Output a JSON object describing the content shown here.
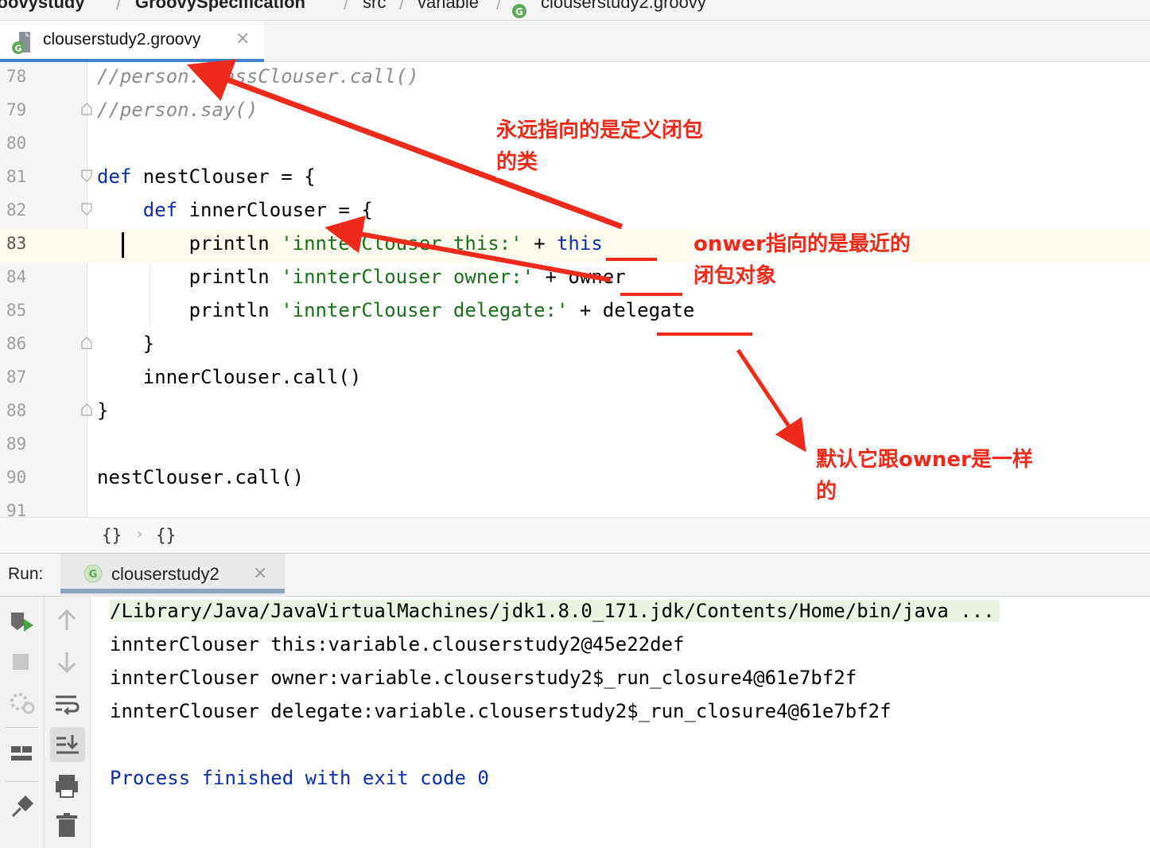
{
  "breadcrumb": {
    "items": [
      "roovystudy",
      "GroovySpecification",
      "src",
      "variable",
      "clouserstudy2.groovy"
    ],
    "separator": "/"
  },
  "editor_tab": {
    "file_name": "clouserstudy2.groovy",
    "close_glyph": "×",
    "icon": "groovy-file-icon"
  },
  "editor": {
    "lines": [
      {
        "num": "78",
        "parts": [
          {
            "t": "//person.classClouser.call()",
            "c": "cmt"
          }
        ]
      },
      {
        "num": "79",
        "parts": [
          {
            "t": "//person.say()",
            "c": "cmt"
          }
        ]
      },
      {
        "num": "80",
        "parts": []
      },
      {
        "num": "81",
        "parts": [
          {
            "t": "def",
            "c": "kw"
          },
          {
            "t": " nestClouser = {",
            "c": ""
          }
        ]
      },
      {
        "num": "82",
        "parts": [
          {
            "t": "    ",
            "c": ""
          },
          {
            "t": "def",
            "c": "kw"
          },
          {
            "t": " innerClouser = {",
            "c": ""
          }
        ]
      },
      {
        "num": "83",
        "parts": [
          {
            "t": "        println ",
            "c": ""
          },
          {
            "t": "'innterClouser this:'",
            "c": "str"
          },
          {
            "t": " + ",
            "c": ""
          },
          {
            "t": "this",
            "c": "kw"
          }
        ],
        "current": true
      },
      {
        "num": "84",
        "parts": [
          {
            "t": "        println ",
            "c": ""
          },
          {
            "t": "'innterClouser owner:'",
            "c": "str"
          },
          {
            "t": " + owner",
            "c": ""
          }
        ]
      },
      {
        "num": "85",
        "parts": [
          {
            "t": "        println ",
            "c": ""
          },
          {
            "t": "'innterClouser delegate:'",
            "c": "str"
          },
          {
            "t": " + delegate",
            "c": ""
          }
        ]
      },
      {
        "num": "86",
        "parts": [
          {
            "t": "    }",
            "c": ""
          }
        ]
      },
      {
        "num": "87",
        "parts": [
          {
            "t": "    innerClouser.call()",
            "c": ""
          }
        ]
      },
      {
        "num": "88",
        "parts": [
          {
            "t": "}",
            "c": ""
          }
        ]
      },
      {
        "num": "89",
        "parts": []
      },
      {
        "num": "90",
        "parts": [
          {
            "t": "nestClouser.call()",
            "c": ""
          }
        ]
      },
      {
        "num": "91",
        "parts": []
      }
    ]
  },
  "structure": {
    "items": [
      "{}",
      "{}"
    ],
    "separator": "›"
  },
  "run": {
    "label": "Run:",
    "tab_label": "clouserstudy2",
    "tab_icon_letter": "G",
    "close_glyph": "×",
    "output": [
      "/Library/Java/JavaVirtualMachines/jdk1.8.0_171.jdk/Contents/Home/bin/java ...",
      "innterClouser this:variable.clouserstudy2@45e22def",
      "innterClouser owner:variable.clouserstudy2$_run_closure4@61e7bf2f",
      "innterClouser delegate:variable.clouserstudy2$_run_closure4@61e7bf2f",
      "",
      "Process finished with exit code 0"
    ],
    "toolbar_left": [
      "rerun-icon",
      "stop-icon",
      "debug-settings-icon",
      "layout-icon",
      "pin-icon"
    ],
    "toolbar_right": [
      "scroll-up-icon",
      "scroll-down-icon",
      "soft-wrap-icon",
      "scroll-to-end-icon",
      "print-icon",
      "trash-icon"
    ]
  },
  "annotations": {
    "this_note": [
      "永远指向的是定义闭包",
      "的类"
    ],
    "owner_note": [
      "onwer指向的是最近的",
      "闭包对象"
    ],
    "delegate_note": [
      "默认它跟owner是一样",
      "的"
    ],
    "color": "#ee2b1a"
  }
}
